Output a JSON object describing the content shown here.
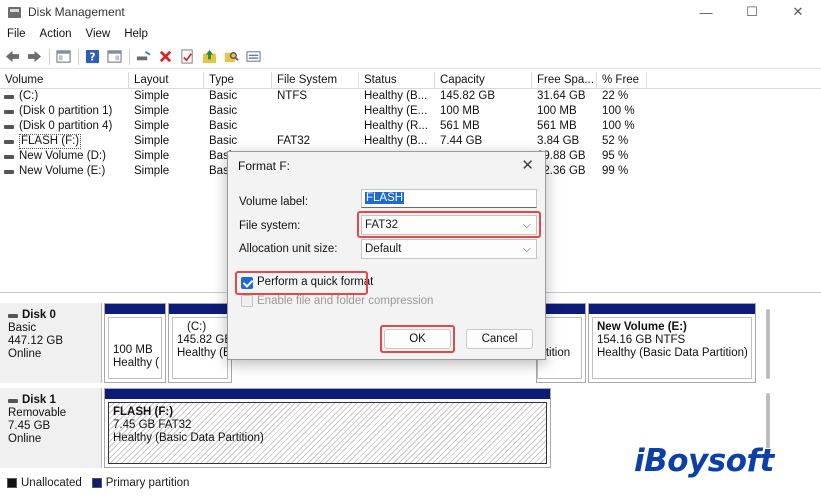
{
  "window": {
    "title": "Disk Management",
    "minimize": "—",
    "maximize": "☐",
    "close": "✕"
  },
  "menu": [
    "File",
    "Action",
    "View",
    "Help"
  ],
  "columns": [
    "Volume",
    "Layout",
    "Type",
    "File System",
    "Status",
    "Capacity",
    "Free Spa...",
    "% Free"
  ],
  "volumes": [
    [
      "(C:)",
      "Simple",
      "Basic",
      "NTFS",
      "Healthy (B...",
      "145.82 GB",
      "31.64 GB",
      "22 %"
    ],
    [
      "(Disk 0 partition 1)",
      "Simple",
      "Basic",
      "",
      "Healthy (E...",
      "100 MB",
      "100 MB",
      "100 %"
    ],
    [
      "(Disk 0 partition 4)",
      "Simple",
      "Basic",
      "",
      "Healthy (R...",
      "561 MB",
      "561 MB",
      "100 %"
    ],
    [
      "FLASH (F:)",
      "Simple",
      "Basic",
      "FAT32",
      "Healthy (B...",
      "7.44 GB",
      "3.84 GB",
      "52 %"
    ],
    [
      "New Volume (D:)",
      "Simple",
      "Basi",
      "",
      "",
      "",
      "89.88 GB",
      "95 %"
    ],
    [
      "New Volume (E:)",
      "Simple",
      "Basi",
      "",
      "",
      "",
      "52.36 GB",
      "99 %"
    ]
  ],
  "disk0": {
    "name": "Disk 0",
    "type": "Basic",
    "size": "447.12 GB",
    "state": "Online",
    "p1": {
      "line1": "100 MB",
      "line2": "Healthy ("
    },
    "p2": {
      "name": "(C:)",
      "line1": "145.82 GB",
      "line2": "Healthy (B"
    },
    "p3": {
      "line2": "rtition"
    },
    "p4": {
      "name": "New Volume  (E:)",
      "line1": "154.16 GB NTFS",
      "line2": "Healthy (Basic Data Partition)"
    }
  },
  "disk1": {
    "name": "Disk 1",
    "type": "Removable",
    "size": "7.45 GB",
    "state": "Online",
    "p1": {
      "name": "FLASH  (F:)",
      "line1": "7.45 GB FAT32",
      "line2": "Healthy (Basic Data Partition)"
    }
  },
  "legend": {
    "unallocated": "Unallocated",
    "primary": "Primary partition"
  },
  "dialog": {
    "title": "Format F:",
    "close": "✕",
    "volume_label_caption": "Volume label:",
    "volume_label_value": "FLASH",
    "file_system_caption": "File system:",
    "file_system_value": "FAT32",
    "alloc_caption": "Allocation unit size:",
    "alloc_value": "Default",
    "quick_format_label": "Perform a quick format",
    "quick_format_checked": true,
    "compression_label": "Enable file and folder compression",
    "compression_enabled": false,
    "ok_label": "OK",
    "cancel_label": "Cancel",
    "chevron": "⌵"
  },
  "watermark": "iBoysoft",
  "colors": {
    "primary_partition": "#0c1c7a",
    "highlight": "#e04a4a",
    "accent": "#1d6ad6"
  }
}
